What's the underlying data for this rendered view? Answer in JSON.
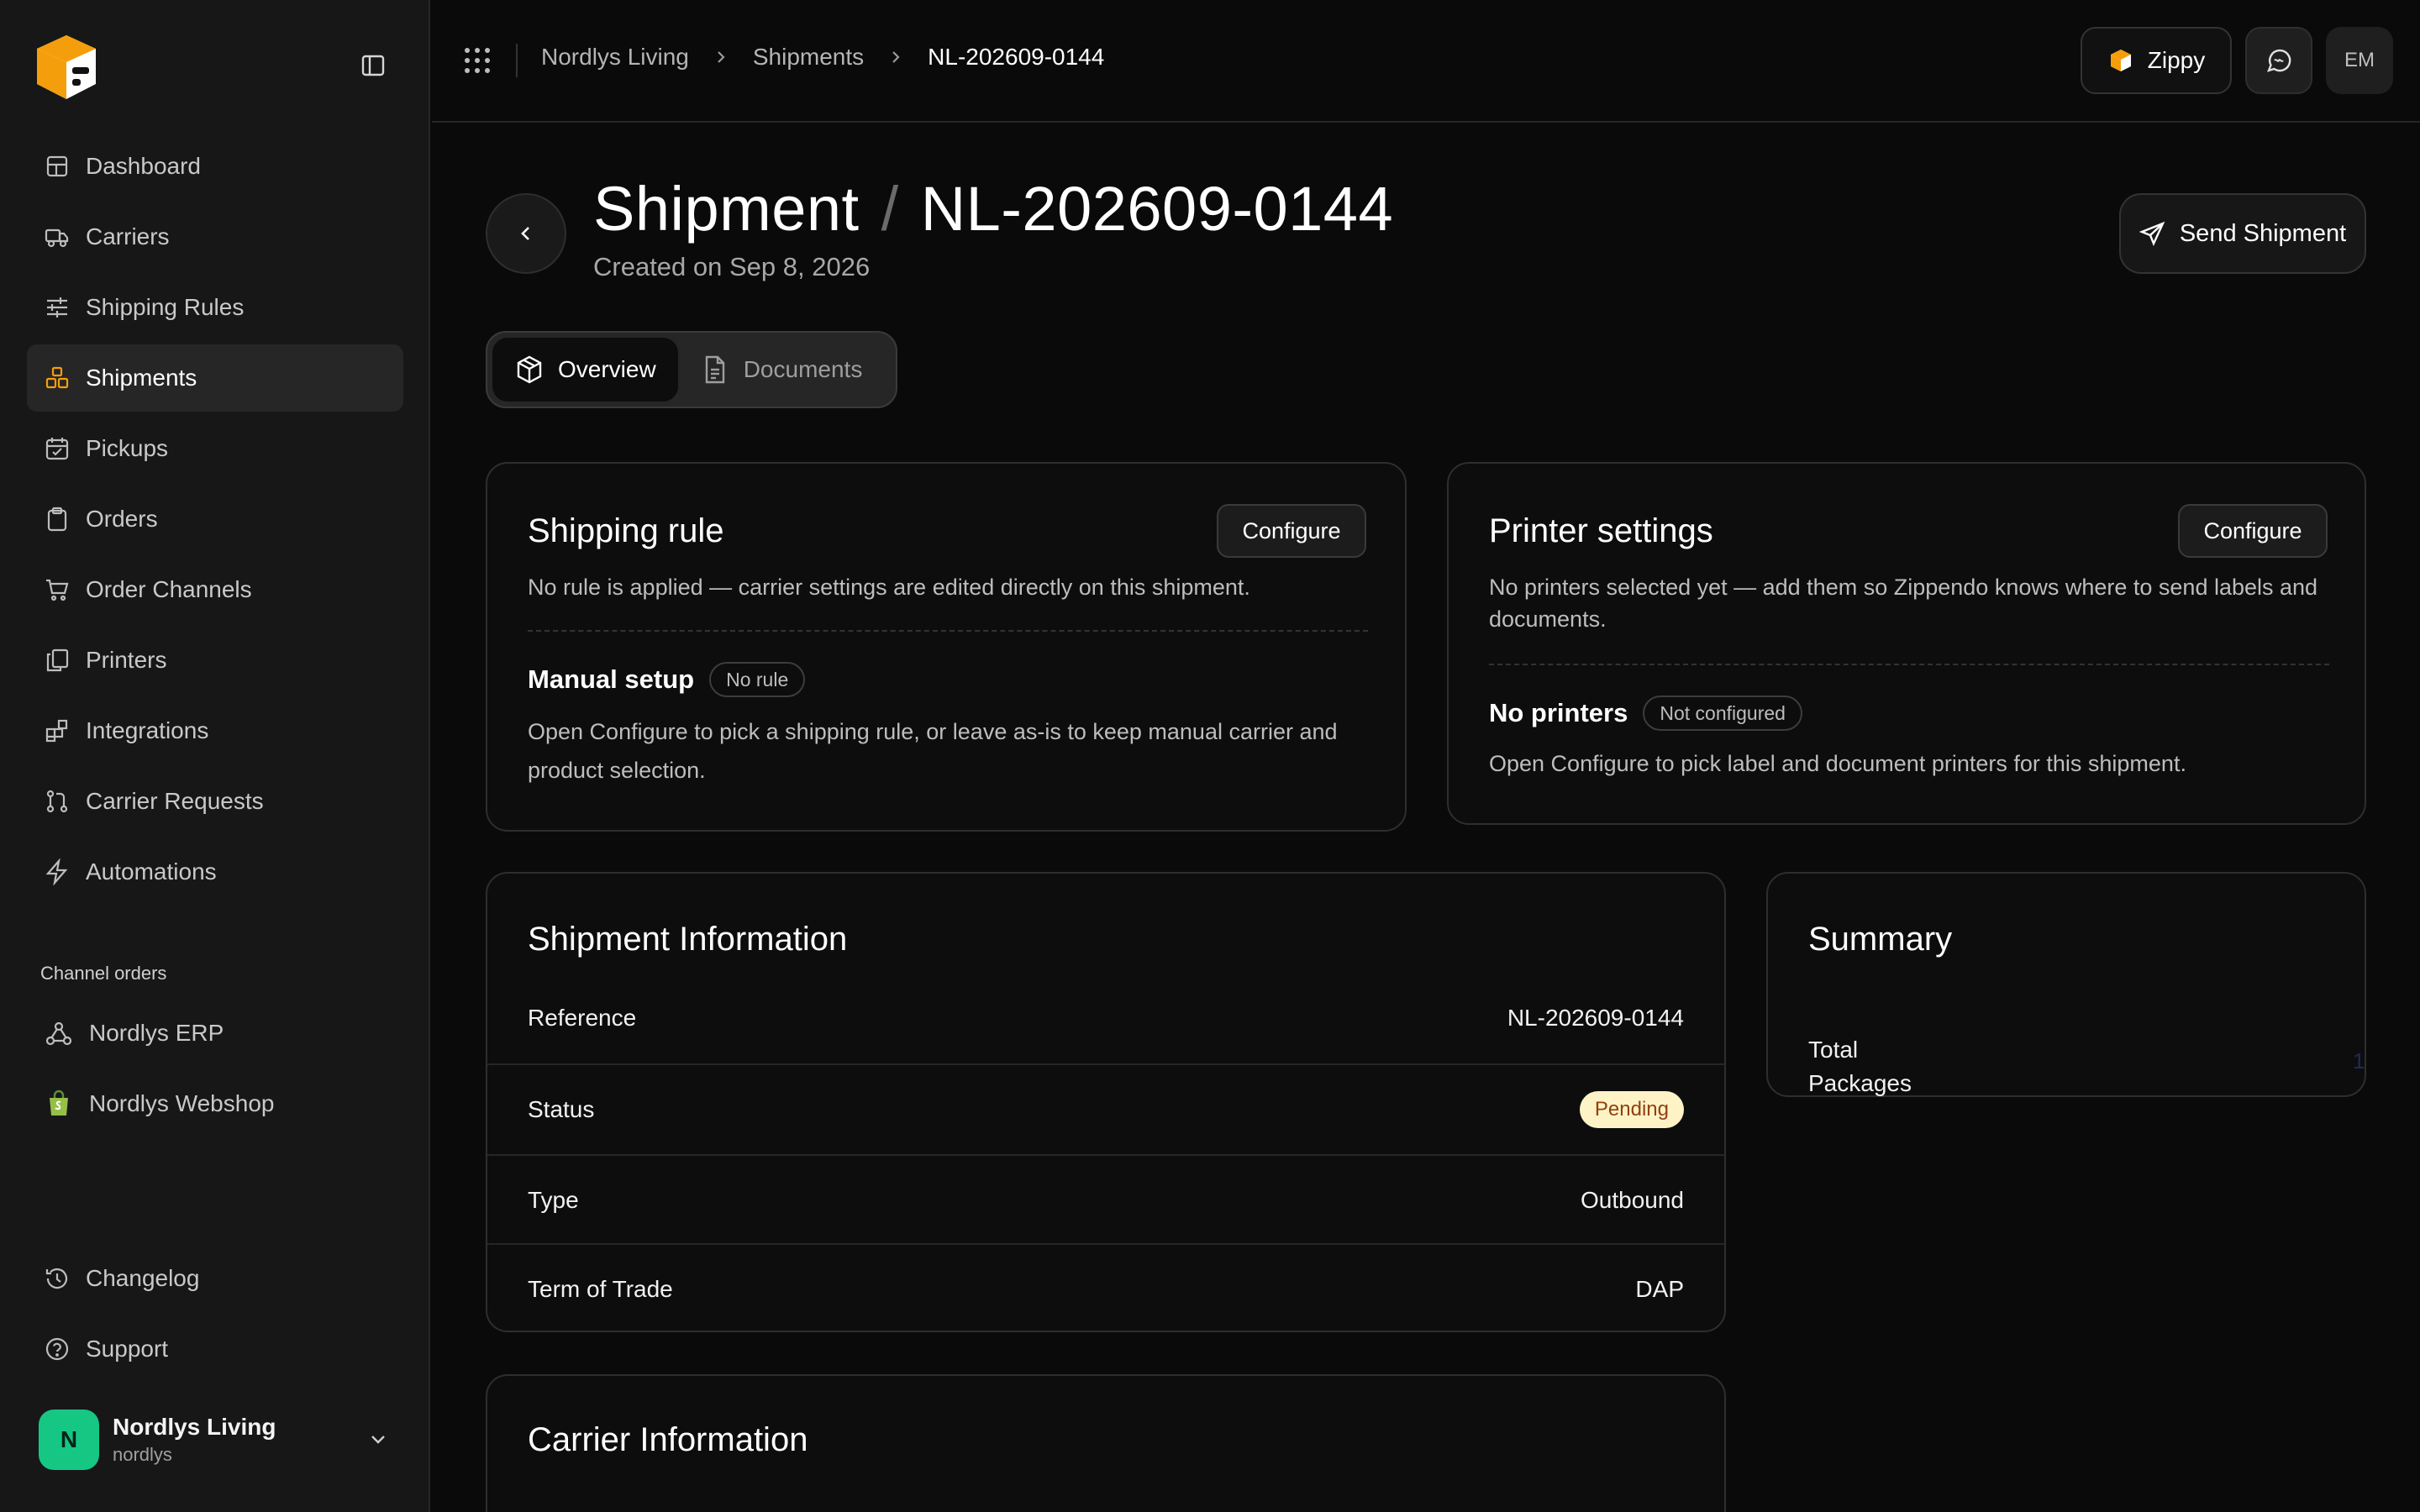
{
  "sidebar": {
    "nav": [
      {
        "label": "Dashboard",
        "icon": "layout-dashboard-icon"
      },
      {
        "label": "Carriers",
        "icon": "truck-icon"
      },
      {
        "label": "Shipping Rules",
        "icon": "sliders-icon"
      },
      {
        "label": "Shipments",
        "icon": "boxes-icon",
        "active": true
      },
      {
        "label": "Pickups",
        "icon": "calendar-check-icon"
      },
      {
        "label": "Orders",
        "icon": "clipboard-icon"
      },
      {
        "label": "Order Channels",
        "icon": "cart-icon"
      },
      {
        "label": "Printers",
        "icon": "copy-icon"
      },
      {
        "label": "Integrations",
        "icon": "blocks-icon"
      },
      {
        "label": "Carrier Requests",
        "icon": "git-pull-request-icon"
      },
      {
        "label": "Automations",
        "icon": "zap-icon"
      }
    ],
    "channels_heading": "Channel orders",
    "channels": [
      {
        "label": "Nordlys ERP",
        "icon": "webhook-icon"
      },
      {
        "label": "Nordlys Webshop",
        "icon": "shopify-bag-icon"
      }
    ],
    "bottom": [
      {
        "label": "Changelog",
        "icon": "history-icon"
      },
      {
        "label": "Support",
        "icon": "help-circle-icon"
      }
    ],
    "user": {
      "initial": "N",
      "name": "Nordlys Living",
      "handle": "nordlys"
    }
  },
  "topbar": {
    "breadcrumb": [
      "Nordlys Living",
      "Shipments",
      "NL-202609-0144"
    ],
    "assistant_label": "Zippy",
    "user_initials": "EM"
  },
  "header": {
    "title_prefix": "Shipment",
    "title_separator": "/",
    "title_id": "NL-202609-0144",
    "created": "Created on Sep 8, 2026",
    "send_label": "Send Shipment"
  },
  "tabs": [
    {
      "label": "Overview",
      "active": true
    },
    {
      "label": "Documents"
    }
  ],
  "shipping_rule": {
    "title": "Shipping rule",
    "configure_label": "Configure",
    "description": "No rule is applied — carrier settings are edited directly on this shipment.",
    "subheading": "Manual setup",
    "badge": "No rule",
    "hint": "Open Configure to pick a shipping rule, or leave as-is to keep manual carrier and product selection."
  },
  "printer_settings": {
    "title": "Printer settings",
    "configure_label": "Configure",
    "description": "No printers selected yet — add them so Zippendo knows where to send labels and documents.",
    "subheading": "No printers",
    "badge": "Not configured",
    "hint": "Open Configure to pick label and document printers for this shipment."
  },
  "shipment_info": {
    "title": "Shipment Information",
    "rows": [
      {
        "label": "Reference",
        "value": "NL-202609-0144"
      },
      {
        "label": "Status",
        "value": "Pending"
      },
      {
        "label": "Type",
        "value": "Outbound"
      },
      {
        "label": "Term of Trade",
        "value": "DAP"
      }
    ]
  },
  "summary": {
    "title": "Summary",
    "total_label": "Total Packages",
    "total_value": "1"
  },
  "carrier_info": {
    "title": "Carrier Information"
  },
  "colors": {
    "accent": "#f59e0b",
    "status_pending_bg": "#fef3c7",
    "status_pending_text": "#92400e",
    "avatar": "#16c784"
  }
}
